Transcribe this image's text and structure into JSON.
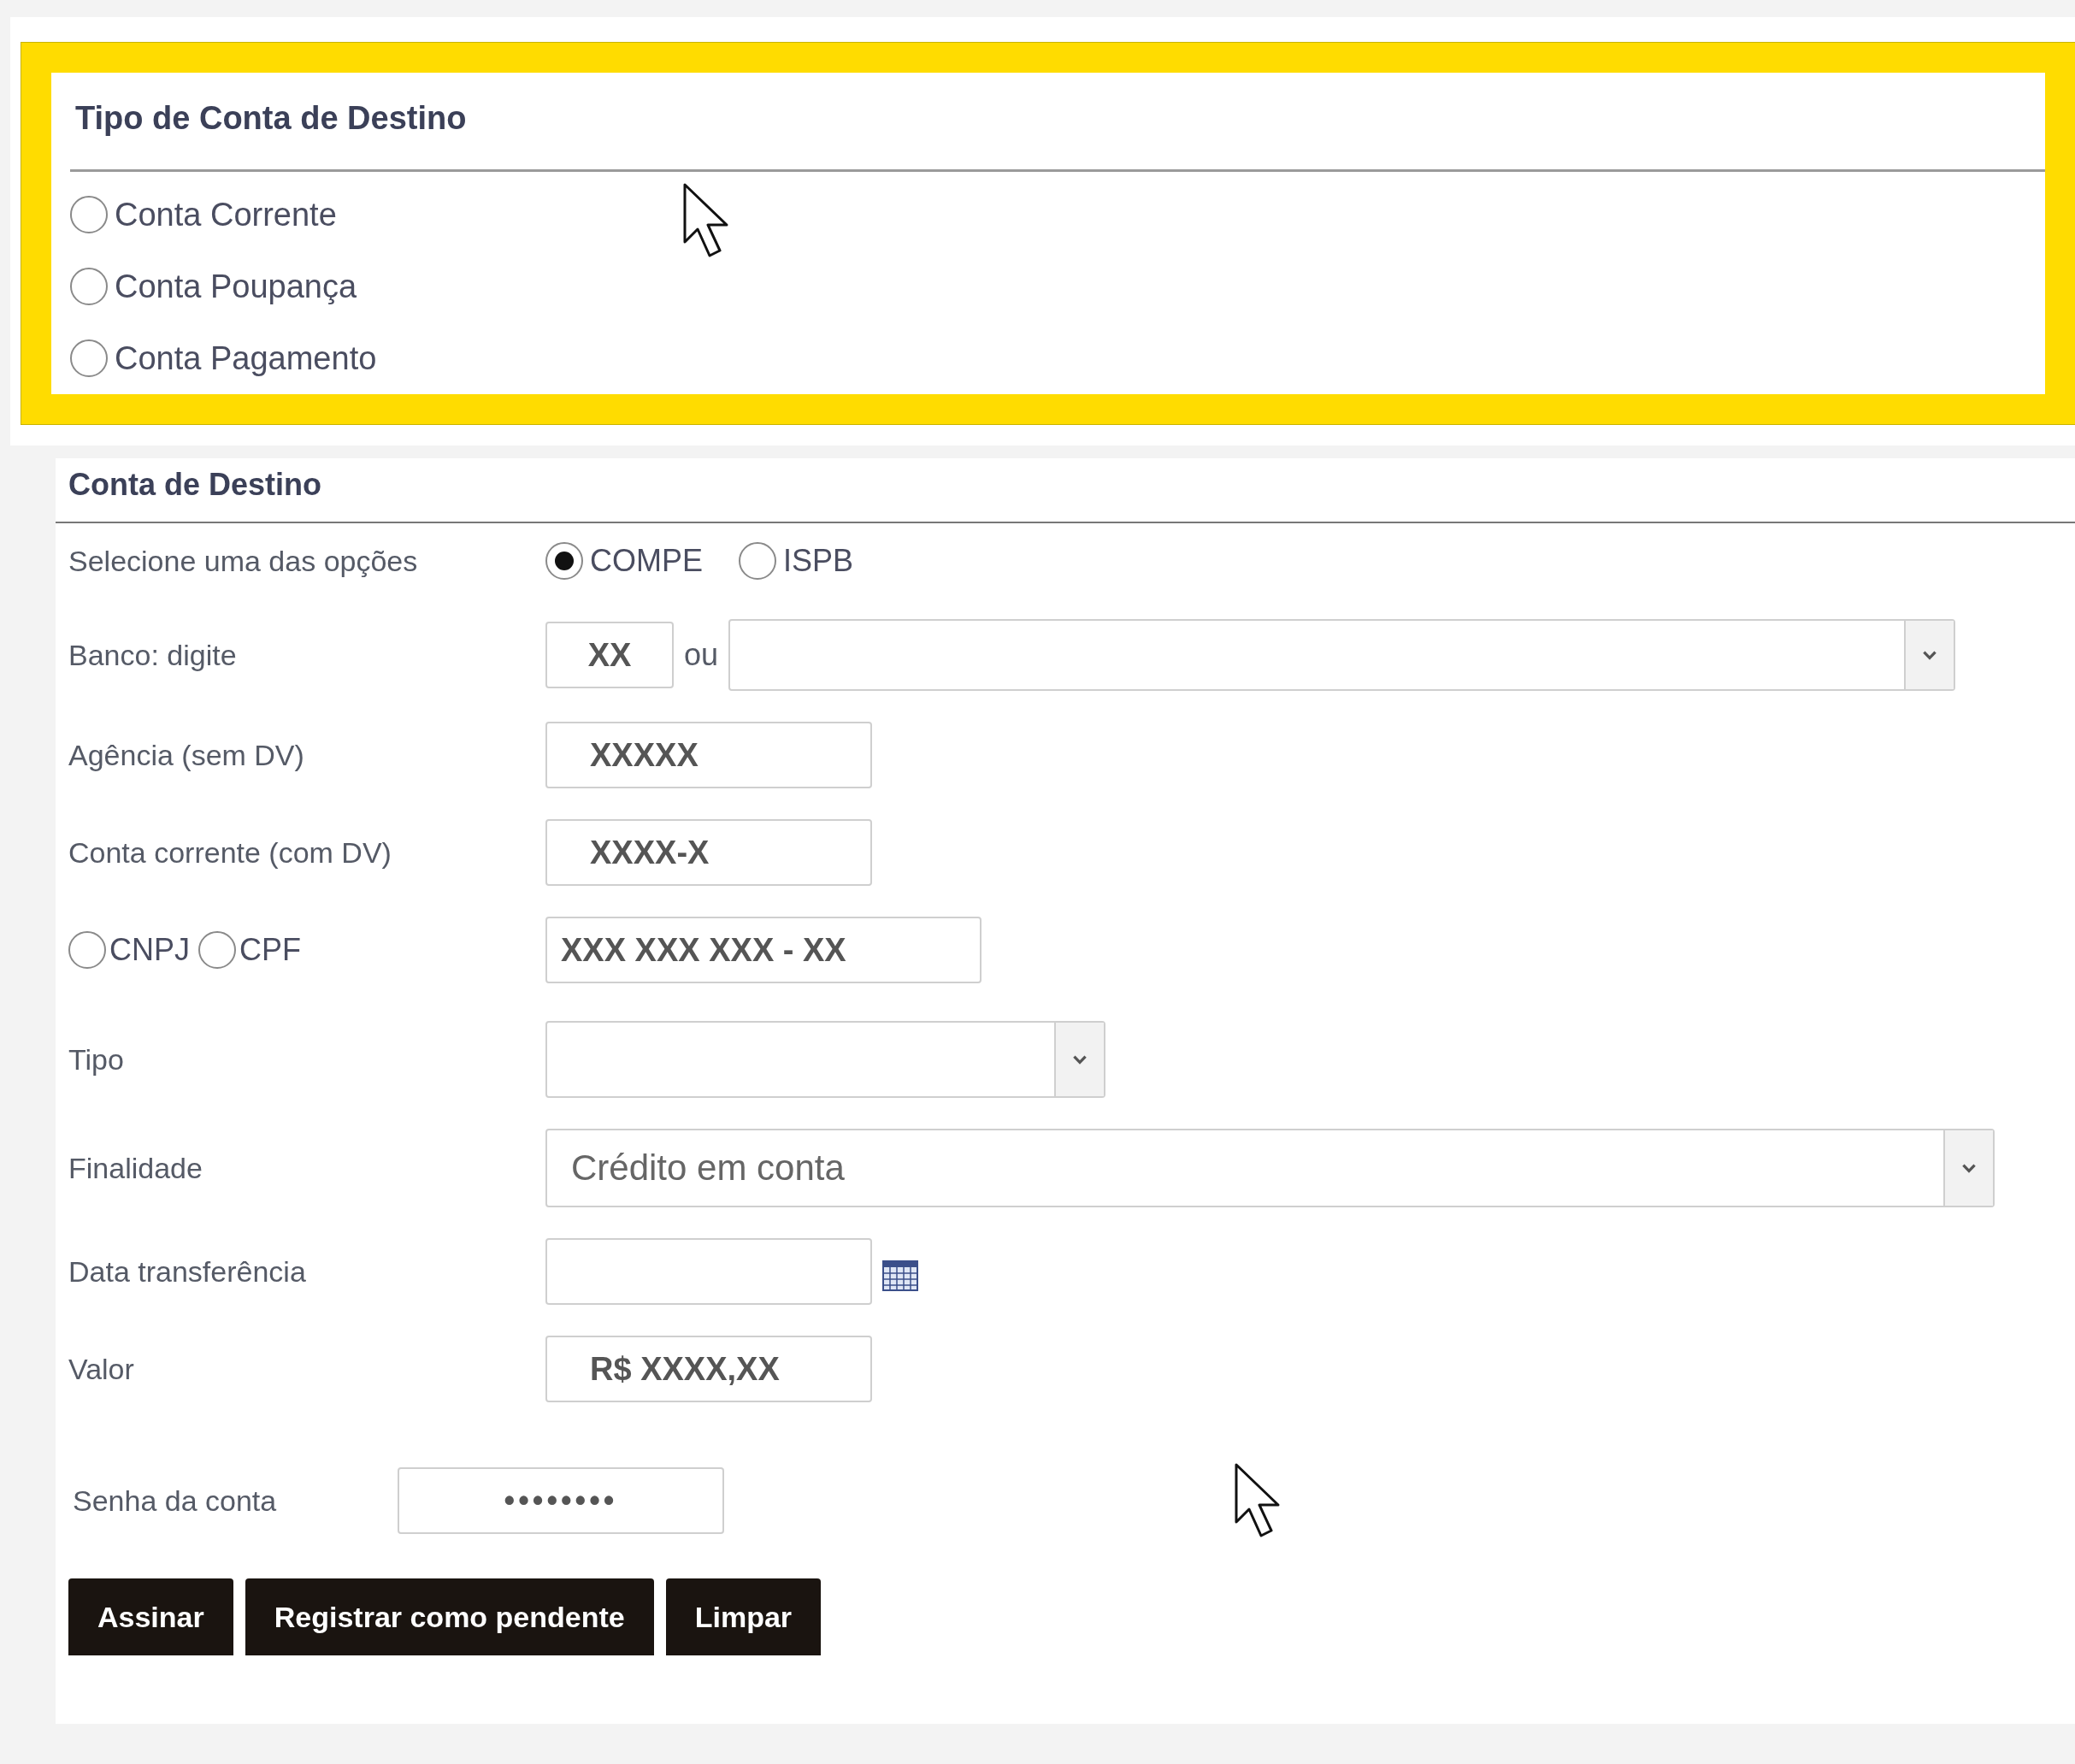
{
  "destination_type": {
    "title": "Tipo de Conta de Destino",
    "options": [
      {
        "label": "Conta Corrente",
        "selected": false
      },
      {
        "label": "Conta Poupança",
        "selected": false
      },
      {
        "label": "Conta Pagamento",
        "selected": false
      }
    ]
  },
  "destination_account": {
    "title": "Conta de Destino",
    "rows": [
      {
        "kind": "choice",
        "label": "Selecione uma das opções",
        "options": [
          {
            "label": "COMPE",
            "selected": true
          },
          {
            "label": "ISPB",
            "selected": false
          }
        ]
      },
      {
        "kind": "bank",
        "label": "Banco: digite",
        "value": "XX",
        "connector": "ou"
      },
      {
        "kind": "text",
        "label": "Agência (sem DV)",
        "value": "XXXXX"
      },
      {
        "kind": "text",
        "label": "Conta corrente (com DV)",
        "value": "XXXX-X"
      },
      {
        "kind": "document",
        "options": [
          {
            "label": "CNPJ",
            "selected": false
          },
          {
            "label": "CPF",
            "selected": false
          }
        ],
        "value": "XXX XXX XXX - XX"
      },
      {
        "kind": "select",
        "label": "Tipo"
      },
      {
        "kind": "select",
        "label": "Finalidade",
        "value": "Crédito em conta"
      },
      {
        "kind": "date",
        "label": "Data transferência"
      },
      {
        "kind": "text",
        "label": "Valor",
        "value": "R$ XXXX,XX"
      },
      {
        "kind": "password",
        "label": "Senha da conta",
        "value": "••••••••"
      }
    ]
  },
  "buttons": [
    "Assinar",
    "Registrar como pendente",
    "Limpar"
  ]
}
